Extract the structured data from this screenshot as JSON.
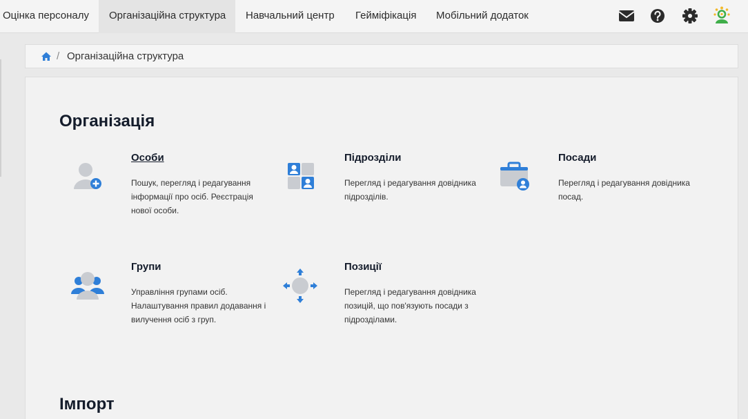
{
  "nav": {
    "tabs": [
      {
        "label": "Оцінка персоналу"
      },
      {
        "label": "Організаційна структура"
      },
      {
        "label": "Навчальний центр"
      },
      {
        "label": "Гейміфікація"
      },
      {
        "label": "Мобільний додаток"
      }
    ],
    "active_tab": "Організаційна структура",
    "icons": [
      "envelope-icon",
      "question-circle-icon",
      "gear-icon",
      "user-avatar-logo"
    ]
  },
  "breadcrumb": {
    "home_icon": "home-icon",
    "separator": "/",
    "current": "Організаційна структура"
  },
  "organization": {
    "title": "Організація",
    "items": [
      {
        "title": "Особи",
        "desc": "Пошук, перегляд і редагування інформації про осіб. Реєстрація нової особи.",
        "icon": "person-add-icon"
      },
      {
        "title": "Підрозділи",
        "desc": "Перегляд і редагування довідника підрозділів.",
        "icon": "departments-icon"
      },
      {
        "title": "Посади",
        "desc": "Перегляд і редагування довідника посад.",
        "icon": "briefcase-person-icon"
      },
      {
        "title": "Групи",
        "desc": "Управління групами осіб. Налаштування правил додавання і вилучення осіб з груп.",
        "icon": "group-icon"
      },
      {
        "title": "Позиції",
        "desc": "Перегляд і редагування довідника позицій, що пов'язують посади з підрозділами.",
        "icon": "position-arrows-icon"
      }
    ]
  },
  "import": {
    "title": "Імпорт"
  },
  "colors": {
    "accent": "#2f7fd8",
    "nav_bg": "#f4f4f4",
    "panel_bg": "#f2f2f2",
    "logo_green": "#3fae49",
    "logo_yellow": "#f2b829"
  }
}
